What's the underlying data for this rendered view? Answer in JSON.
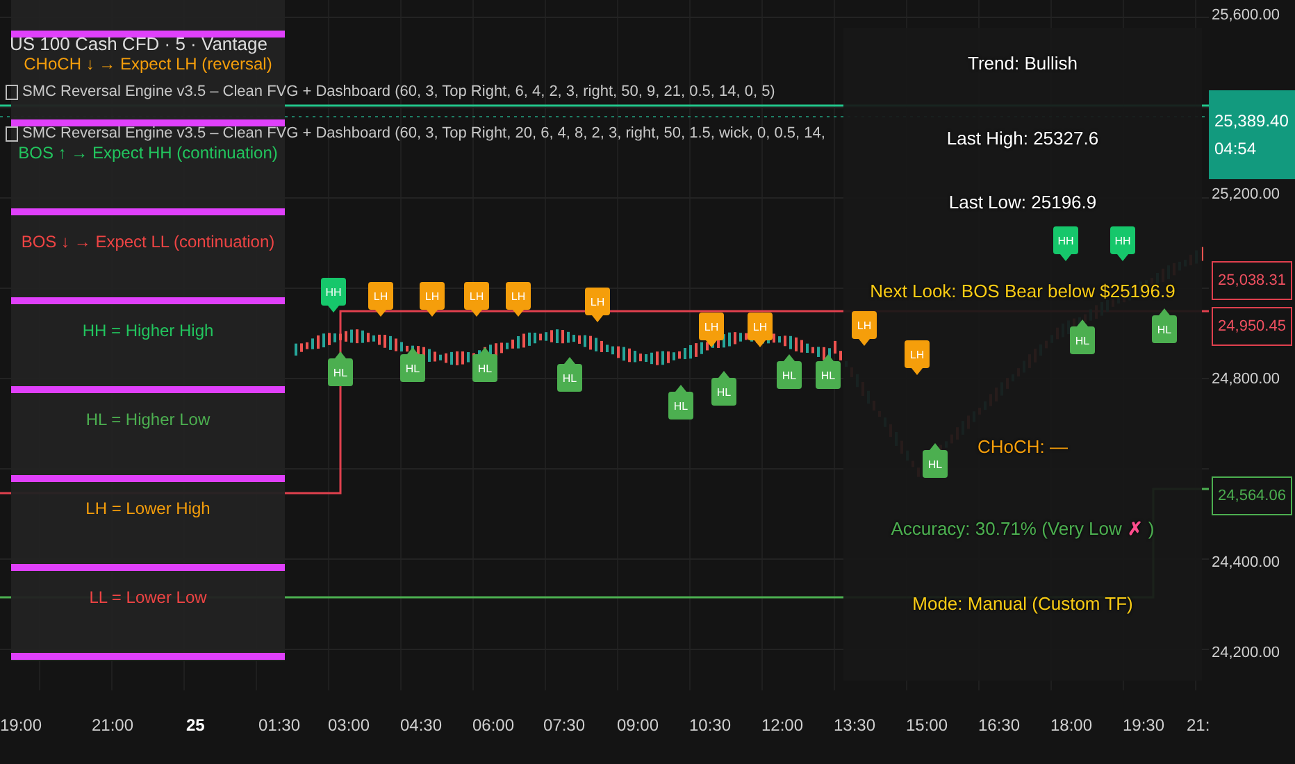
{
  "header": {
    "title": "US 100 Cash CFD · 5 · Vantage",
    "indicators": [
      "SMC Reversal Engine v3.5 – Clean FVG + Dashboard (60, 3, Top Right, 6, 4, 2, 3, right, 50, 9, 21, 0.5, 14, 0, 5)",
      "SMC Reversal Engine v3.5 – Clean FVG + Dashboard (60, 3, Top Right, 20, 6, 4, 8, 2, 3, right, 50, 1.5, wick, 0, 0.5, 14,"
    ]
  },
  "legend": [
    {
      "text": "CHoCH ↓ → Expect LH (reversal)",
      "color": "#f59e0b"
    },
    {
      "text": "BOS ↑ → Expect HH (continuation)",
      "color": "#22c55e"
    },
    {
      "text": "BOS ↓ → Expect LL (continuation)",
      "color": "#ef4444"
    },
    {
      "text": "HH = Higher High",
      "color": "#22c55e"
    },
    {
      "text": "HL = Higher Low",
      "color": "#4caf50"
    },
    {
      "text": "LH = Lower High",
      "color": "#f59e0b"
    },
    {
      "text": "LL = Lower Low",
      "color": "#ef4444"
    }
  ],
  "pivots": [
    {
      "label": "HH",
      "kind": "high",
      "color": "#16c76b"
    },
    {
      "label": "HL",
      "kind": "low",
      "color": "#4caf50"
    },
    {
      "label": "LH",
      "kind": "high",
      "color": "#f59e0b"
    },
    {
      "label": "HL",
      "kind": "low",
      "color": "#4caf50"
    },
    {
      "label": "LH",
      "kind": "high",
      "color": "#f59e0b"
    },
    {
      "label": "LH",
      "kind": "high",
      "color": "#f59e0b"
    },
    {
      "label": "HL",
      "kind": "low",
      "color": "#4caf50"
    },
    {
      "label": "LH",
      "kind": "high",
      "color": "#f59e0b"
    },
    {
      "label": "HL",
      "kind": "low",
      "color": "#4caf50"
    },
    {
      "label": "LH",
      "kind": "high",
      "color": "#f59e0b"
    },
    {
      "label": "HL",
      "kind": "low",
      "color": "#4caf50"
    },
    {
      "label": "LH",
      "kind": "high",
      "color": "#f59e0b"
    },
    {
      "label": "HL",
      "kind": "low",
      "color": "#4caf50"
    },
    {
      "label": "LH",
      "kind": "high",
      "color": "#f59e0b"
    },
    {
      "label": "HL",
      "kind": "low",
      "color": "#4caf50"
    },
    {
      "label": "HL",
      "kind": "low",
      "color": "#4caf50"
    },
    {
      "label": "LH",
      "kind": "high",
      "color": "#f59e0b"
    },
    {
      "label": "LH",
      "kind": "high",
      "color": "#f59e0b"
    },
    {
      "label": "HL",
      "kind": "low",
      "color": "#4caf50"
    },
    {
      "label": "HH",
      "kind": "high",
      "color": "#16c76b"
    },
    {
      "label": "HL",
      "kind": "low",
      "color": "#4caf50"
    },
    {
      "label": "HH",
      "kind": "high",
      "color": "#16c76b"
    },
    {
      "label": "HL",
      "kind": "low",
      "color": "#4caf50"
    }
  ],
  "dashboard": [
    {
      "kind": "plain",
      "text": "Trend: Bullish",
      "color": "#ffffff"
    },
    {
      "kind": "plain",
      "text": "Last High: 25327.6",
      "color": "#ffffff"
    },
    {
      "kind": "plain",
      "text": "Last Low: 25196.9",
      "color": "#ffffff"
    },
    {
      "kind": "plain",
      "text": "Next Look: BOS Bear below $25196.9",
      "color": "#facc15"
    },
    {
      "kind": "plain",
      "text": "CHoCH: —",
      "color": "#f59e0b"
    },
    {
      "kind": "accuracy",
      "text": "Accuracy: 30.71% (Very Low",
      "mark": "✗",
      "close": ")",
      "color": "#4caf50"
    },
    {
      "kind": "plain",
      "text": "Mode: Manual (Custom TF)",
      "color": "#facc15"
    }
  ],
  "price_axis": [
    {
      "text": "25,600.00",
      "kind": "plain"
    },
    {
      "text": "25,200.00",
      "kind": "plain"
    },
    {
      "text": "25,038.31",
      "kind": "red"
    },
    {
      "text": "24,950.45",
      "kind": "red"
    },
    {
      "text": "24,800.00",
      "kind": "plain"
    },
    {
      "text": "24,564.06",
      "kind": "green"
    },
    {
      "text": "24,400.00",
      "kind": "plain"
    },
    {
      "text": "24,200.00",
      "kind": "plain"
    }
  ],
  "current_price": {
    "price": "25,389.40",
    "countdown": "04:54"
  },
  "time_axis": [
    {
      "text": "19:00",
      "bold": false
    },
    {
      "text": "21:00",
      "bold": false
    },
    {
      "text": "25",
      "bold": true
    },
    {
      "text": "01:30",
      "bold": false
    },
    {
      "text": "03:00",
      "bold": false
    },
    {
      "text": "04:30",
      "bold": false
    },
    {
      "text": "06:00",
      "bold": false
    },
    {
      "text": "07:30",
      "bold": false
    },
    {
      "text": "09:00",
      "bold": false
    },
    {
      "text": "10:30",
      "bold": false
    },
    {
      "text": "12:00",
      "bold": false
    },
    {
      "text": "13:30",
      "bold": false
    },
    {
      "text": "15:00",
      "bold": false
    },
    {
      "text": "16:30",
      "bold": false
    },
    {
      "text": "18:00",
      "bold": false
    },
    {
      "text": "19:30",
      "bold": false
    },
    {
      "text": "21:",
      "bold": false
    }
  ]
}
